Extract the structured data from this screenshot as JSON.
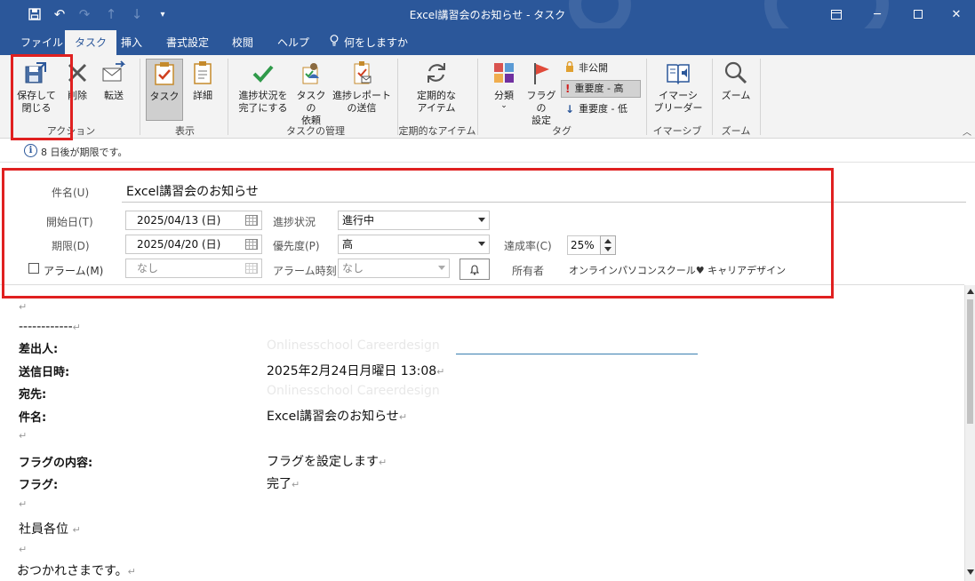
{
  "window": {
    "title": "Excel講習会のお知らせ  -  タスク"
  },
  "tabs": [
    {
      "label": "ファイル"
    },
    {
      "label": "タスク"
    },
    {
      "label": "挿入"
    },
    {
      "label": "書式設定"
    },
    {
      "label": "校閲"
    },
    {
      "label": "ヘルプ"
    },
    {
      "label": "何をしますか"
    }
  ],
  "ribbon": {
    "actions": {
      "save_close": "保存して\n閉じる",
      "delete": "削除",
      "forward": "転送",
      "group": "アクション"
    },
    "show": {
      "task": "タスク",
      "details": "詳細",
      "group": "表示"
    },
    "manage": {
      "mark_complete": "進捗状況を\n完了にする",
      "assign": "タスクの\n依頼",
      "send_report": "進捗レポート\nの送信",
      "group": "タスクの管理"
    },
    "recurrence": {
      "recurrence": "定期的な\nアイテム",
      "group": "定期的なアイテム"
    },
    "tags": {
      "categorize": "分類",
      "follow_up": "フラグの\n設定",
      "private": "非公開",
      "high": "重要度 - 高",
      "low": "重要度 - 低",
      "group": "タグ"
    },
    "immersive": {
      "reader": "イマーシ\nブリーダー",
      "group": "イマーシブ"
    },
    "zoom": {
      "zoom": "ズーム",
      "group": "ズーム"
    }
  },
  "infobar": {
    "text": "8 日後が期限です。"
  },
  "form": {
    "subject_label": "件名(U)",
    "subject_value": "Excel講習会のお知らせ",
    "start_label": "開始日(T)",
    "start_value": "2025/04/13 (日)",
    "due_label": "期限(D)",
    "due_value": "2025/04/20 (日)",
    "status_label": "進捗状況",
    "status_value": "進行中",
    "priority_label": "優先度(P)",
    "priority_value": "高",
    "complete_label": "達成率(C)",
    "complete_value": "25%",
    "alarm_label": "アラーム(M)",
    "alarm_date": "なし",
    "alarm_time_label": "アラーム時刻",
    "alarm_time": "なし",
    "owner_label": "所有者",
    "owner_value": "オンラインパソコンスクール♥ キャリアデザイン"
  },
  "body": {
    "dashes": "------------",
    "from_label": "差出人:",
    "from_value": "Onlinesschool Careerdesign",
    "sent_label": "送信日時:",
    "sent_value": "2025年2月24日月曜日  13:08",
    "to_label": "宛先:",
    "to_value": "Onlinesschool Careerdesign",
    "subject_label": "件名:",
    "subject_value": "Excel講習会のお知らせ",
    "flag_content_label": "フラグの内容:",
    "flag_content_value": "フラグを設定します",
    "flag_label": "フラグ:",
    "flag_value": "完了",
    "greeting": "社員各位",
    "closing": "おつかれさまです。",
    "para_mark": "↵"
  },
  "colors": {
    "accent": "#2b579a",
    "highlight": "#e02020"
  }
}
